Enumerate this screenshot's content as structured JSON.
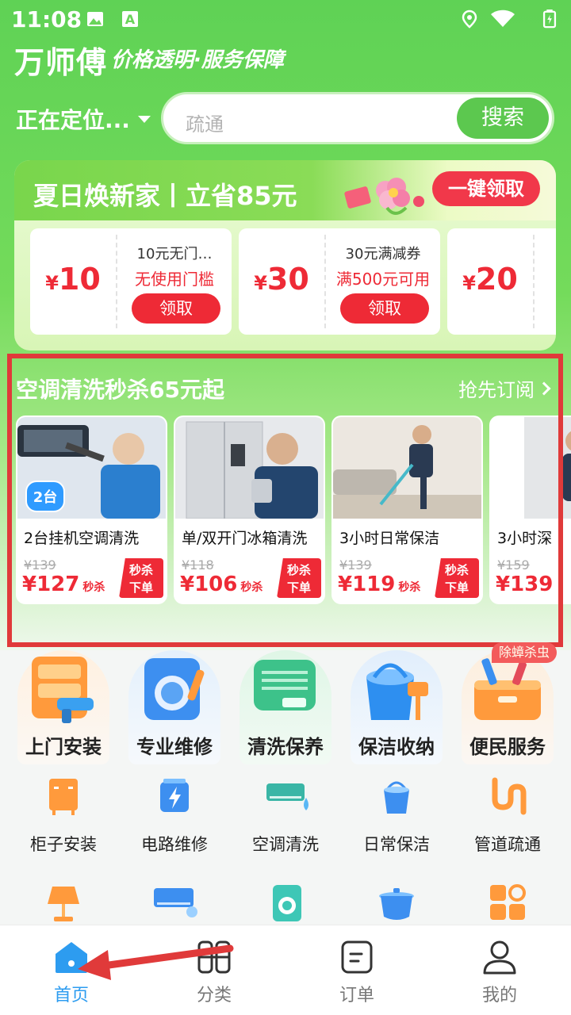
{
  "status_bar": {
    "time": "11:08"
  },
  "header": {
    "brand": "万师傅",
    "slogan": "价格透明·服务保障",
    "location": "正在定位..."
  },
  "search": {
    "placeholder": "疏通",
    "button": "搜索"
  },
  "coupon_banner": {
    "title": "夏日焕新家丨立省85元",
    "claim_all": "一键领取",
    "coupons": [
      {
        "currency": "¥",
        "amount": "10",
        "name": "10元无门…",
        "condition": "无使用门槛",
        "claim": "领取"
      },
      {
        "currency": "¥",
        "amount": "30",
        "name": "30元满减券",
        "condition": "满500元可用",
        "claim": "领取"
      },
      {
        "currency": "¥",
        "amount": "20"
      }
    ]
  },
  "flash_sale": {
    "title": "空调清洗秒杀65元起",
    "more": "抢先订阅",
    "badge_text_top": "秒杀",
    "badge_text_bottom": "下单",
    "price_tag": "秒杀",
    "items": [
      {
        "name": "2台挂机空调清洗",
        "old_price": "¥139",
        "price": "¥127",
        "overlay": "2台"
      },
      {
        "name": "单/双开门冰箱清洗",
        "old_price": "¥118",
        "price": "¥106"
      },
      {
        "name": "3小时日常保洁",
        "old_price": "¥139",
        "price": "¥119"
      },
      {
        "name": "3小时深",
        "old_price": "¥159",
        "price": "¥139"
      }
    ]
  },
  "categories": {
    "hot_tag": "除蟑杀虫",
    "main": [
      "上门安装",
      "专业维修",
      "清洗保养",
      "保洁收纳",
      "便民服务"
    ],
    "sub": [
      "柜子安装",
      "电路维修",
      "空调清洗",
      "日常保洁",
      "管道疏通"
    ],
    "row3_icons": [
      "lamp-icon",
      "ac-repair-icon",
      "washer-icon",
      "pot-icon",
      "grid-apps-icon"
    ]
  },
  "bottom_nav": {
    "items": [
      {
        "label": "首页",
        "icon": "home-icon",
        "active": true
      },
      {
        "label": "分类",
        "icon": "category-icon",
        "active": false
      },
      {
        "label": "订单",
        "icon": "order-icon",
        "active": false
      },
      {
        "label": "我的",
        "icon": "profile-icon",
        "active": false
      }
    ]
  },
  "colors": {
    "primary_green": "#5cc84f",
    "accent_red": "#ee2a36",
    "nav_active": "#2d9cf0"
  }
}
